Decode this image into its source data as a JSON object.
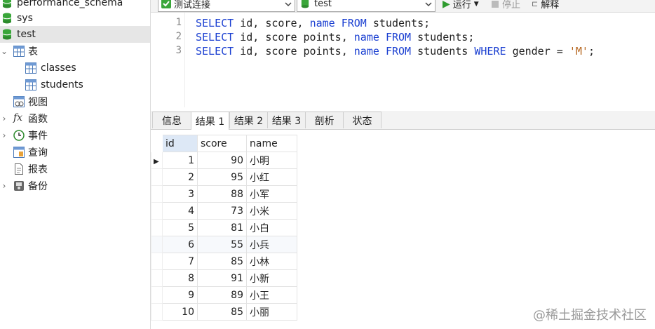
{
  "sidebar": {
    "items": [
      {
        "label": "performance_schema",
        "icon": "database-icon"
      },
      {
        "label": "sys",
        "icon": "database-icon"
      },
      {
        "label": "test",
        "icon": "database-icon"
      },
      {
        "label": "表",
        "icon": "table-icon"
      },
      {
        "label": "classes",
        "icon": "table-icon"
      },
      {
        "label": "students",
        "icon": "table-icon"
      },
      {
        "label": "视图",
        "icon": "view-icon"
      },
      {
        "label": "函数",
        "icon": "function-icon"
      },
      {
        "label": "事件",
        "icon": "clock-icon"
      },
      {
        "label": "查询",
        "icon": "query-icon"
      },
      {
        "label": "报表",
        "icon": "report-icon"
      },
      {
        "label": "备份",
        "icon": "backup-icon"
      }
    ]
  },
  "toolbar": {
    "connection": "测试连接",
    "database": "test",
    "run": "运行",
    "stop": "停止",
    "explain": "解释"
  },
  "editor": {
    "line_numbers": [
      "1",
      "2",
      "3"
    ],
    "lines": [
      "SELECT id, score, name FROM students;",
      "SELECT id, score points, name FROM students;",
      "SELECT id, score points, name FROM students WHERE gender = 'M';"
    ]
  },
  "result_tabs": [
    "信息",
    "结果 1",
    "结果 2",
    "结果 3",
    "剖析",
    "状态"
  ],
  "result": {
    "columns": [
      "id",
      "score",
      "name"
    ],
    "rows": [
      [
        "1",
        "90",
        "小明"
      ],
      [
        "2",
        "95",
        "小红"
      ],
      [
        "3",
        "88",
        "小军"
      ],
      [
        "4",
        "73",
        "小米"
      ],
      [
        "5",
        "81",
        "小白"
      ],
      [
        "6",
        "55",
        "小兵"
      ],
      [
        "7",
        "85",
        "小林"
      ],
      [
        "8",
        "91",
        "小新"
      ],
      [
        "9",
        "89",
        "小王"
      ],
      [
        "10",
        "85",
        "小丽"
      ]
    ]
  },
  "watermark": "@稀土掘金技术社区",
  "colors": {
    "keyword": "#1a3fd1",
    "string": "#b5651d",
    "db_green": "#3aa63a"
  }
}
